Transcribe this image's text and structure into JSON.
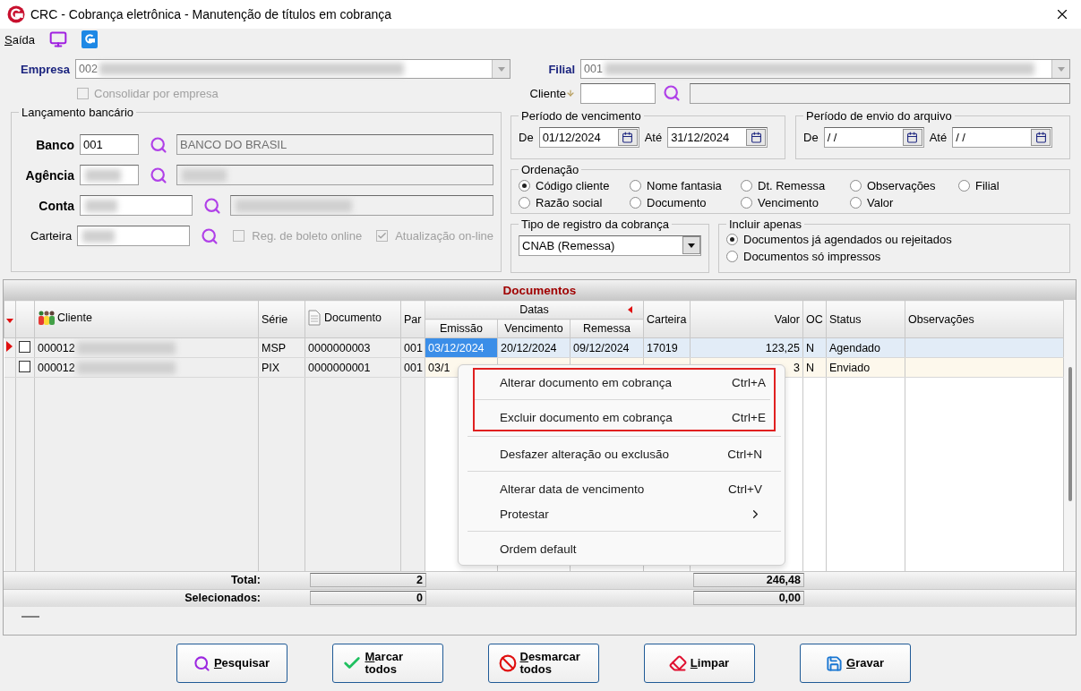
{
  "window": {
    "title": "CRC - Cobrança eletrônica - Manutenção de títulos em cobrança"
  },
  "menu_bar": {
    "exit": "Saída"
  },
  "empresa": {
    "label": "Empresa",
    "value": "002",
    "redacted": true
  },
  "consolidar": {
    "label": "Consolidar por empresa",
    "checked": false,
    "disabled": true
  },
  "filial": {
    "label": "Filial",
    "value": "001",
    "redacted": true
  },
  "cliente": {
    "label": "Cliente"
  },
  "lancamento": {
    "title": "Lançamento bancário",
    "fields": [
      {
        "kind": "lookup",
        "label": "Banco",
        "emphasis": true,
        "value": "001",
        "description": "BANCO DO BRASIL",
        "wide": false
      },
      {
        "kind": "lookup",
        "label": "Agência",
        "emphasis": true,
        "wide": false,
        "redacted": true
      },
      {
        "kind": "lookup",
        "label": "Conta",
        "emphasis": true,
        "wide": true,
        "redacted": true
      },
      {
        "kind": "options",
        "label": "Carteira",
        "emphasis": false,
        "wide": true,
        "redacted": true
      }
    ],
    "options": [
      {
        "label": "Reg. de boleto online",
        "checked": false,
        "disabled": true
      },
      {
        "label": "Atualização on-line",
        "checked": true,
        "disabled": true
      }
    ]
  },
  "periods": [
    {
      "title": "Período de vencimento",
      "from_label": "De",
      "from": "01/12/2024",
      "to_label": "Até",
      "to": "31/12/2024"
    },
    {
      "title": "Período de envio do arquivo",
      "from_label": "De",
      "from": "/ /",
      "to_label": "Até",
      "to": "/ /"
    }
  ],
  "ordering": {
    "title": "Ordenação",
    "options": [
      {
        "label": "Código cliente",
        "selected": true
      },
      {
        "label": "Nome fantasia",
        "selected": false
      },
      {
        "label": "Dt. Remessa",
        "selected": false
      },
      {
        "label": "Observações",
        "selected": false
      },
      {
        "label": "Filial",
        "selected": false
      },
      {
        "label": "Razão social",
        "selected": false
      },
      {
        "label": "Documento",
        "selected": false
      },
      {
        "label": "Vencimento",
        "selected": false
      },
      {
        "label": "Valor",
        "selected": false
      }
    ]
  },
  "registro": {
    "title": "Tipo de registro da cobrança",
    "value": "CNAB (Remessa)"
  },
  "incluir": {
    "title": "Incluir apenas",
    "options": [
      {
        "label": "Documentos já agendados ou rejeitados",
        "selected": true
      },
      {
        "label": "Documentos só impressos",
        "selected": false
      }
    ]
  },
  "grid": {
    "title": "Documentos",
    "group": "Datas",
    "columns": [
      {
        "label": "Cliente"
      },
      {
        "label": "Série"
      },
      {
        "label": "Documento"
      },
      {
        "label": "Par"
      },
      {
        "label": "Emissão"
      },
      {
        "label": "Vencimento"
      },
      {
        "label": "Remessa"
      },
      {
        "label": "Carteira"
      },
      {
        "label": "Valor"
      },
      {
        "label": "OC"
      },
      {
        "label": "Status"
      },
      {
        "label": "Observações"
      }
    ],
    "rows": [
      {
        "selected": true,
        "checked": false,
        "redacted": true,
        "cells": [
          {
            "text": "000012",
            "focused": false
          },
          {
            "text": "MSP",
            "focused": false
          },
          {
            "text": "0000000003",
            "focused": false
          },
          {
            "text": "001",
            "focused": false
          },
          {
            "text": "03/12/2024",
            "focused": true
          },
          {
            "text": "20/12/2024",
            "focused": false
          },
          {
            "text": "09/12/2024",
            "focused": false
          },
          {
            "text": "17019",
            "focused": false
          },
          {
            "text": "123,25",
            "focused": false
          },
          {
            "text": "N",
            "focused": false
          },
          {
            "text": "Agendado",
            "focused": false
          },
          {
            "focused": false
          }
        ]
      },
      {
        "selected": false,
        "checked": false,
        "redacted": true,
        "cells": [
          {
            "text": "000012",
            "focused": false
          },
          {
            "text": "PIX",
            "focused": false
          },
          {
            "text": "0000000001",
            "focused": false
          },
          {
            "text": "001",
            "focused": false
          },
          {
            "text": "03/1",
            "focused": false
          },
          null,
          null,
          null,
          {
            "text": "3",
            "focused": false
          },
          {
            "text": "N",
            "focused": false
          },
          {
            "text": "Enviado",
            "focused": false
          },
          {
            "focused": false
          }
        ]
      }
    ],
    "totals": [
      {
        "label": "Total:",
        "count": "2",
        "value": "246,48"
      },
      {
        "label": "Selecionados:",
        "count": "0",
        "value": "0,00"
      }
    ]
  },
  "context_menu": {
    "groups": [
      {
        "marked": true,
        "sections": [
          [
            {
              "label": "Alterar documento em cobrança",
              "shortcut": "Ctrl+A",
              "submenu": false
            }
          ],
          [
            {
              "label": "Excluir documento em cobrança",
              "shortcut": "Ctrl+E",
              "submenu": false
            }
          ]
        ]
      },
      {
        "marked": false,
        "sections": [
          [
            {
              "label": "Desfazer alteração ou exclusão",
              "shortcut": "Ctrl+N",
              "submenu": false
            }
          ],
          [
            {
              "label": "Alterar data de vencimento",
              "shortcut": "Ctrl+V",
              "submenu": false
            },
            {
              "label": "Protestar",
              "submenu": true
            }
          ],
          [
            {
              "label": "Ordem default",
              "submenu": false
            }
          ]
        ]
      }
    ]
  },
  "buttons": [
    {
      "label": "Pesquisar",
      "kind": "search"
    },
    {
      "label": "Marcar todos",
      "kind": "check"
    },
    {
      "label": "Desmarcar todos",
      "kind": "ban"
    },
    {
      "label": "Limpar",
      "kind": "eraser"
    },
    {
      "label": "Gravar",
      "kind": "save"
    }
  ]
}
